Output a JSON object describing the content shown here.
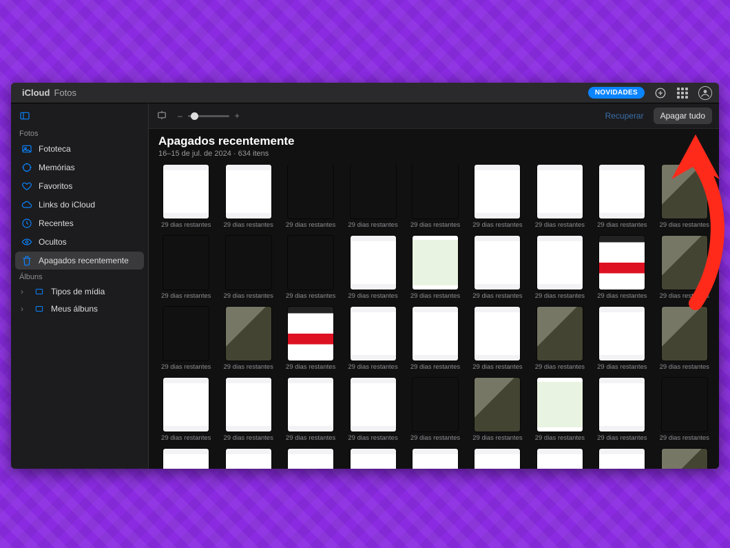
{
  "brand": {
    "name": "iCloud",
    "section": "Fotos"
  },
  "titlebar": {
    "novidades": "NOVIDADES"
  },
  "sidebar": {
    "section_fotos": "Fotos",
    "items": [
      {
        "label": "Fototeca"
      },
      {
        "label": "Memórias"
      },
      {
        "label": "Favoritos"
      },
      {
        "label": "Links do iCloud"
      },
      {
        "label": "Recentes"
      },
      {
        "label": "Ocultos"
      },
      {
        "label": "Apagados recentemente"
      }
    ],
    "section_albuns": "Álbuns",
    "albums": [
      {
        "label": "Tipos de mídia"
      },
      {
        "label": "Meus álbuns"
      }
    ]
  },
  "toolbar": {
    "recover": "Recuperar",
    "delete_all": "Apagar tudo",
    "zoom_minus": "–",
    "zoom_plus": "+"
  },
  "heading": {
    "title": "Apagados recentemente",
    "subtitle": "16–15 de jul. de 2024  ·  634 itens"
  },
  "thumb_caption": "29 dias restantes",
  "thumb_styles": [
    "light",
    "light",
    "dark",
    "dark",
    "dark",
    "light",
    "light",
    "light",
    "photo",
    "dark",
    "dark",
    "dark",
    "light",
    "chat",
    "light",
    "light",
    "mix",
    "photo",
    "dark",
    "photo",
    "mix",
    "light",
    "light",
    "light",
    "photo",
    "light",
    "photo",
    "light",
    "light",
    "light",
    "light",
    "dark",
    "photo",
    "chat",
    "light",
    "dark",
    "light",
    "light",
    "light",
    "light",
    "light",
    "light",
    "light",
    "light",
    "photo"
  ]
}
